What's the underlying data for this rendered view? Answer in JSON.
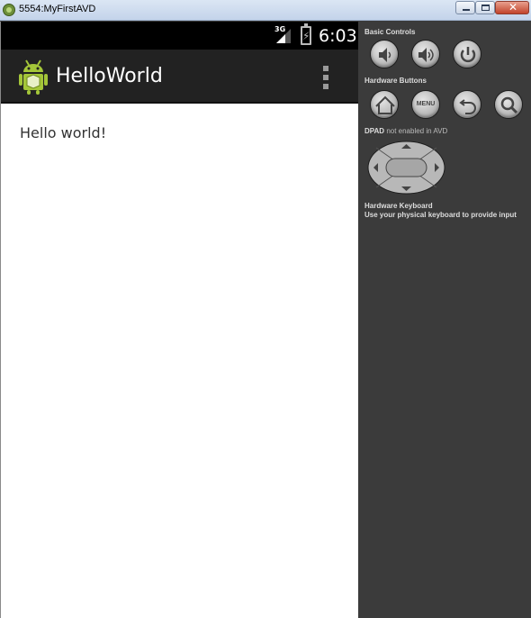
{
  "window": {
    "title": "5554:MyFirstAVD"
  },
  "statusbar": {
    "network": "3G",
    "time": "6:03"
  },
  "actionbar": {
    "app_name": "HelloWorld"
  },
  "content": {
    "text": "Hello world!"
  },
  "panel": {
    "basic_controls_label": "Basic Controls",
    "hardware_buttons_label": "Hardware Buttons",
    "dpad_label": "DPAD",
    "dpad_status": "not enabled in AVD",
    "keyboard_title": "Hardware Keyboard",
    "keyboard_hint": "Use your physical keyboard to provide input",
    "menu_label": "MENU"
  },
  "colors": {
    "screen_bg": "#ffffff",
    "actionbar_bg": "#222222",
    "panel_bg": "#3b3b3b",
    "android_green": "#a4c639"
  },
  "icons": [
    "app-icon",
    "signal-icon",
    "battery-icon",
    "android-logo",
    "overflow-menu-icon",
    "volume-down-icon",
    "volume-up-icon",
    "power-icon",
    "home-icon",
    "back-icon",
    "search-icon",
    "dpad"
  ]
}
